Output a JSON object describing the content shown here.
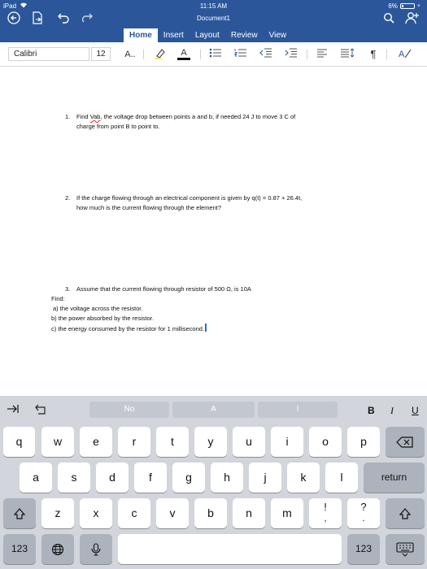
{
  "status_bar": {
    "device": "iPad",
    "time": "11:15 AM",
    "battery": "6%"
  },
  "app": {
    "title": "Document1"
  },
  "tabs": [
    {
      "label": "Home",
      "active": true
    },
    {
      "label": "Insert",
      "active": false
    },
    {
      "label": "Layout",
      "active": false
    },
    {
      "label": "Review",
      "active": false
    },
    {
      "label": "View",
      "active": false
    }
  ],
  "ribbon": {
    "font_name": "Calibri",
    "font_size": "12",
    "grow_font": "A..",
    "font_color_glyph": "A",
    "accent_color": "#2b579a"
  },
  "document": {
    "q1_num": "1.",
    "q1_pre": "Find ",
    "q1_word": "Vab",
    "q1_rest": ", the voltage drop between points a and b, if needed 24 J to move 3 C of",
    "q1_line2": "charge from point B to point to.",
    "q2_num": "2.",
    "q2_line1": "If the charge flowing through an electrical component is given by q(t) = 0.87 + 26.4t,",
    "q2_line2": "how much is the current flowing through the element?",
    "q3_num": "3.",
    "q3_line1": "Assume that the current flowing through resistor of 500 Ω, is 10A",
    "q3_find": "Find:",
    "q3_a": "a) the voltage across the resistor.",
    "q3_b": "b) the power absorbed by the resistor.",
    "q3_c": "c) the energy consumed by the resistor for 1 millisecond."
  },
  "keyboard": {
    "suggestions": [
      "No",
      "A",
      "I"
    ],
    "format": {
      "bold": "B",
      "italic": "I",
      "underline": "U"
    },
    "row1": [
      "q",
      "w",
      "e",
      "r",
      "t",
      "y",
      "u",
      "i",
      "o",
      "p"
    ],
    "row2": [
      "a",
      "s",
      "d",
      "f",
      "g",
      "h",
      "j",
      "k",
      "l"
    ],
    "row3": [
      "z",
      "x",
      "c",
      "v",
      "b",
      "n",
      "m",
      "!",
      "?"
    ],
    "row3_alt": [
      ",",
      "."
    ],
    "return_label": "return",
    "numbers_label": "123"
  }
}
